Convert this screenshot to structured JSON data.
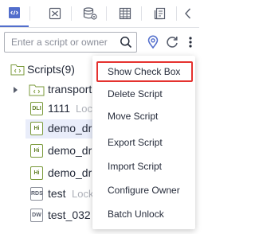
{
  "toolbar": {
    "tabs": [
      {
        "icon": "code-icon",
        "active": true
      },
      {
        "icon": "function-icon",
        "active": false
      },
      {
        "icon": "database-settings-icon",
        "active": false
      },
      {
        "icon": "table-icon",
        "active": false
      },
      {
        "icon": "document-list-icon",
        "active": false
      }
    ],
    "collapse_icon": "chevron-left-icon"
  },
  "search": {
    "placeholder": "Enter a script or owner"
  },
  "tree": {
    "root_label": "Scripts(9)",
    "items": [
      {
        "label": "transport",
        "type": "folder"
      },
      {
        "icon_text": "DLI",
        "label": "1111",
        "lock": "Lock"
      },
      {
        "icon_text": "Hi",
        "label": "demo_dr",
        "selected": true
      },
      {
        "icon_text": "Hi",
        "label": "demo_dr"
      },
      {
        "icon_text": "Hi",
        "label": "demo_dr"
      },
      {
        "icon_text": "RDS",
        "label": "test",
        "lock": "Lock"
      },
      {
        "icon_text": "DW",
        "label": "test_032"
      }
    ]
  },
  "menu": {
    "items": [
      "Show Check Box",
      "Delete Script",
      "Move Script",
      "Export Script",
      "Import Script",
      "Configure Owner",
      "Batch Unlock"
    ]
  },
  "colors": {
    "accent": "#526ecc",
    "highlight_border": "#e5322f",
    "selected_row": "#e9edfa"
  }
}
